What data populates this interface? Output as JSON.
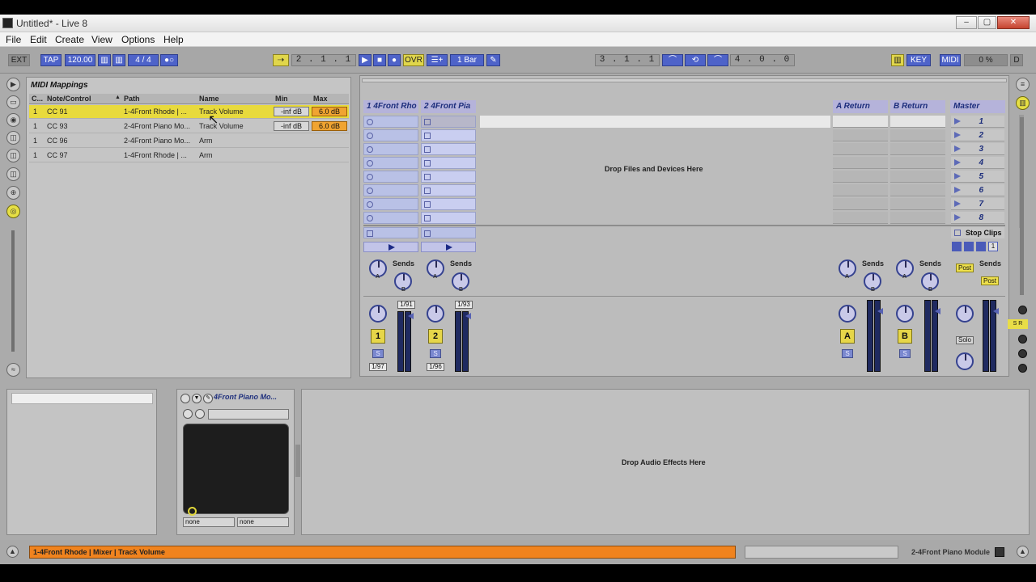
{
  "window": {
    "title": "Untitled* - Live 8"
  },
  "menu": [
    "File",
    "Edit",
    "Create",
    "View",
    "Options",
    "Help"
  ],
  "transport": {
    "ext": "EXT",
    "tap": "TAP",
    "tempo": "120.00",
    "signature": "4 / 4",
    "position": "2 .  1 .  1",
    "ovr": "OVR",
    "quantize": "1 Bar",
    "loop_start": "3 .  1 .  1",
    "loop_length": "4 .  0 .  0",
    "key": "KEY",
    "midi": "MIDI",
    "cpu": "0 %",
    "d": "D"
  },
  "browser": {
    "title": "MIDI Mappings",
    "columns": [
      "C...",
      "Note/Control",
      "Path",
      "Name",
      "Min",
      "Max"
    ],
    "rows": [
      {
        "ch": "1",
        "control": "CC 91",
        "path": "1-4Front Rhode | ...",
        "name": "Track Volume",
        "min": "-inf dB",
        "max": "6.0 dB",
        "selected": true
      },
      {
        "ch": "1",
        "control": "CC 93",
        "path": "2-4Front Piano Mo...",
        "name": "Track Volume",
        "min": "-inf dB",
        "max": "6.0 dB",
        "selected": false
      },
      {
        "ch": "1",
        "control": "CC 96",
        "path": "2-4Front Piano Mo...",
        "name": "Arm",
        "min": "",
        "max": "",
        "selected": false
      },
      {
        "ch": "1",
        "control": "CC 97",
        "path": "1-4Front Rhode | ...",
        "name": "Arm",
        "min": "",
        "max": "",
        "selected": false
      }
    ]
  },
  "session": {
    "tracks": [
      "1 4Front Rho",
      "2 4Front Pia"
    ],
    "returns": [
      "A Return",
      "B Return"
    ],
    "master": "Master",
    "drop_label": "Drop Files and Devices Here",
    "scenes": [
      "1",
      "2",
      "3",
      "4",
      "5",
      "6",
      "7",
      "8"
    ],
    "stop_clips": "Stop Clips",
    "sends": "Sends",
    "knob_a": "A",
    "knob_b": "B",
    "track1": {
      "num": "1",
      "solo": "S",
      "in": "1/91",
      "out": "1/97"
    },
    "track2": {
      "num": "2",
      "solo": "S",
      "in": "1/93",
      "out": "1/96"
    },
    "return_a": {
      "label": "A",
      "solo": "S"
    },
    "return_b": {
      "label": "B",
      "solo": "S"
    },
    "post": "Post",
    "solo_label": "Solo",
    "scene_count": "1"
  },
  "device": {
    "title": "4Front Piano Mo...",
    "select_x": "none",
    "select_y": "none"
  },
  "drop_audio": "Drop Audio Effects Here",
  "status": {
    "message": "1-4Front Rhode | Mixer | Track Volume",
    "right": "2-4Front Piano Module"
  },
  "colors": {
    "accent_yellow": "#e8da3d",
    "status_orange": "#f0831e",
    "clip_blue": "#b9c1e6",
    "max_orange": "#f0a431"
  }
}
